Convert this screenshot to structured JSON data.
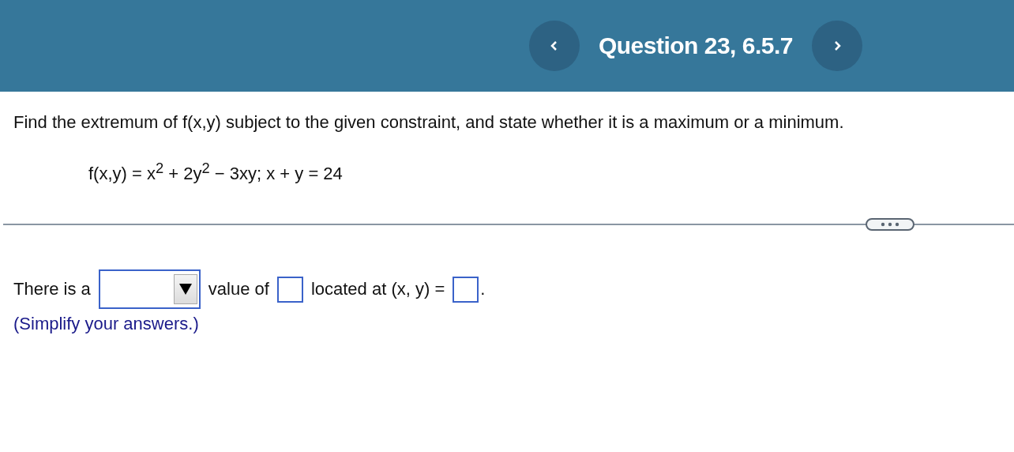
{
  "header": {
    "title": "Question 23, 6.5.7"
  },
  "question": {
    "prompt": "Find the extremum of f(x,y) subject to the given constraint, and state whether it is a maximum or a minimum.",
    "formula": "f(x,y) = x$^{2}$ + 2y$^{2}$ − 3xy; x + y = 24"
  },
  "answer": {
    "text_1": "There is a",
    "text_2": "value of",
    "text_3": "located at (x, y) =",
    "text_4": ".",
    "hint": "(Simplify your answers.)"
  }
}
